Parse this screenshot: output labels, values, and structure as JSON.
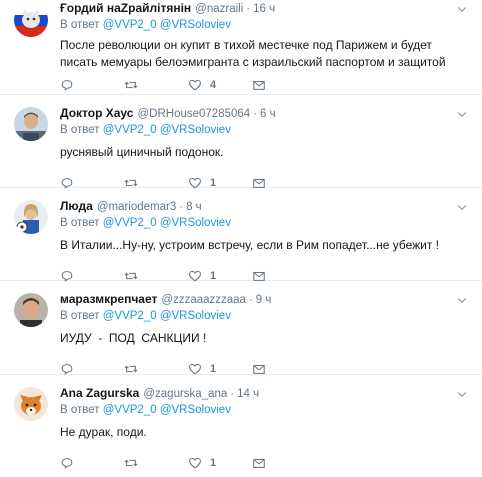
{
  "tweets": [
    {
      "name": "Ғордий наZрайлітянін",
      "handle": "@nazraili",
      "time": "16 ч",
      "reply_prefix": "В ответ",
      "mentions": [
        "@VVP2_0",
        "@VRSoloviev"
      ],
      "text": "После революции он купит в тихой местечке под Парижем и будет писать мемуары белоэмигранта с израильский паспортом и защитой",
      "likes": "4",
      "avatar": "cat-flag-avatar"
    },
    {
      "name": "Доктор Хаус",
      "handle": "@DRHouse07285064",
      "time": "6 ч",
      "reply_prefix": "В ответ",
      "mentions": [
        "@VVP2_0",
        "@VRSoloviev"
      ],
      "text": "руснявый циничный подонок.",
      "likes": "1",
      "avatar": "man-avatar"
    },
    {
      "name": "Люда",
      "handle": "@mariodemar3",
      "time": "8 ч",
      "reply_prefix": "В ответ",
      "mentions": [
        "@VVP2_0",
        "@VRSoloviev"
      ],
      "text": "В Италии...Ну-ну, устроим встречу, если в Рим попадет...не убежит !",
      "likes": "1",
      "avatar": "woman-avatar"
    },
    {
      "name": "маразмкрепчает",
      "handle": "@zzzaaazzzaaa",
      "time": "9 ч",
      "reply_prefix": "В ответ",
      "mentions": [
        "@VVP2_0",
        "@VRSoloviev"
      ],
      "text": "ИУДУ  -  ПОД  САНКЦИИ !",
      "likes": "1",
      "avatar": "man-portrait-avatar"
    },
    {
      "name": "Ana Zagurska",
      "handle": "@zagurska_ana",
      "time": "14 ч",
      "reply_prefix": "В ответ",
      "mentions": [
        "@VVP2_0",
        "@VRSoloviev"
      ],
      "text": "Не дурак, поди.",
      "likes": "1",
      "avatar": "fox-avatar"
    }
  ],
  "colors": {
    "mention": "#1b95e0",
    "muted": "#657786",
    "divider": "#e6ecf0"
  }
}
